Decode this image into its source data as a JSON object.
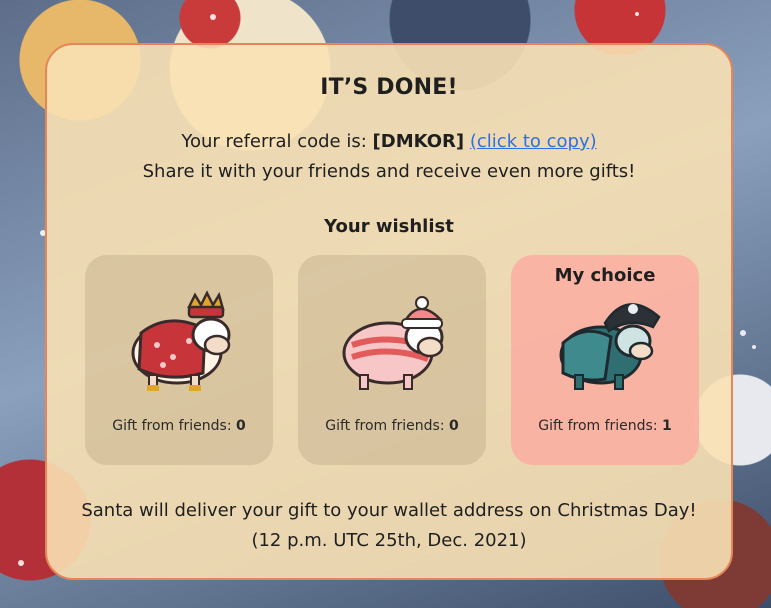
{
  "modal": {
    "title": "IT’S DONE!",
    "referral_prefix": "Your referral code is:",
    "referral_code": "[DMKOR]",
    "copy_link": "(click to copy)",
    "share_text": "Share it with your friends and receive even more gifts!",
    "wishlist_title": "Your wishlist",
    "gifts": [
      {
        "icon": "king-sheep-icon",
        "count_label": "Gift from friends:",
        "count": "0",
        "selected": false,
        "choice_label": ""
      },
      {
        "icon": "winter-sheep-icon",
        "count_label": "Gift from friends:",
        "count": "0",
        "selected": false,
        "choice_label": ""
      },
      {
        "icon": "pirate-sheep-icon",
        "count_label": "Gift from friends:",
        "count": "1",
        "selected": true,
        "choice_label": "My choice"
      }
    ],
    "footer_line1": "Santa will deliver your gift to your wallet address on Christmas Day!",
    "footer_line2": "(12 p.m. UTC 25th, Dec. 2021)"
  },
  "colors": {
    "card_border": "#e4865a",
    "card_bg": "#f8e1b4",
    "link": "#2f6fe0",
    "selected_bg": "#fcaaa0"
  }
}
